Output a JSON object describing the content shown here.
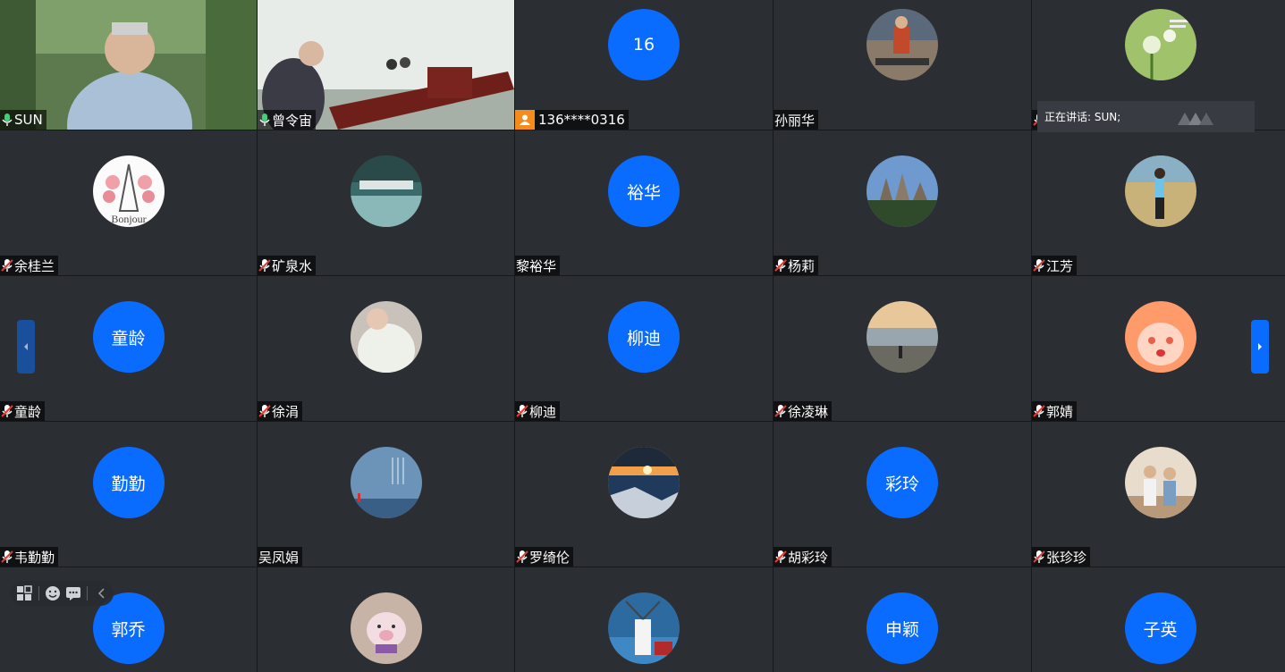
{
  "speaking_banner": "正在讲话: SUN;",
  "toolbar": {
    "buttons": [
      "layout-icon",
      "emoji-icon",
      "chat-icon",
      "collapse-icon"
    ]
  },
  "colors": {
    "accent_blue": "#0a6cff",
    "tile_bg": "#2b2e33",
    "speaking_border": "#4fd08a",
    "phone_icon_bg": "#f38b1d",
    "muted_mic_red": "#e53935"
  },
  "participants": [
    {
      "name": "SUN",
      "mic": "on",
      "type": "video",
      "scene": "outdoor"
    },
    {
      "name": "曾令宙",
      "mic": "on",
      "type": "video",
      "scene": "meeting-room"
    },
    {
      "name": "136****0316",
      "mic": "phone",
      "type": "initials",
      "initials": "16"
    },
    {
      "name": "孙丽华",
      "mic": "none",
      "type": "photo",
      "scene": "person-exercise"
    },
    {
      "name": "",
      "mic": "muted",
      "type": "photo",
      "scene": "flower"
    },
    {
      "name": "余桂兰",
      "mic": "muted",
      "type": "photo",
      "scene": "eiffel"
    },
    {
      "name": "矿泉水",
      "mic": "muted",
      "type": "photo",
      "scene": "bridge-lake"
    },
    {
      "name": "黎裕华",
      "mic": "none",
      "type": "initials",
      "initials": "裕华"
    },
    {
      "name": "杨莉",
      "mic": "muted",
      "type": "photo",
      "scene": "castle"
    },
    {
      "name": "江芳",
      "mic": "muted",
      "type": "photo",
      "scene": "person-field"
    },
    {
      "name": "童龄",
      "mic": "muted",
      "type": "initials",
      "initials": "童龄"
    },
    {
      "name": "徐涓",
      "mic": "muted",
      "type": "photo",
      "scene": "white-shirt"
    },
    {
      "name": "柳迪",
      "mic": "muted",
      "type": "initials",
      "initials": "柳迪"
    },
    {
      "name": "徐凌琳",
      "mic": "muted",
      "type": "photo",
      "scene": "sunset-beach"
    },
    {
      "name": "郭婧",
      "mic": "muted",
      "type": "photo",
      "scene": "anime-girl"
    },
    {
      "name": "韦勤勤",
      "mic": "muted",
      "type": "initials",
      "initials": "勤勤"
    },
    {
      "name": "吴凤娟",
      "mic": "none",
      "type": "photo",
      "scene": "sea-text"
    },
    {
      "name": "罗绮伦",
      "mic": "muted",
      "type": "photo",
      "scene": "sunset-rocks"
    },
    {
      "name": "胡彩玲",
      "mic": "muted",
      "type": "initials",
      "initials": "彩玲"
    },
    {
      "name": "张珍珍",
      "mic": "muted",
      "type": "photo",
      "scene": "couple"
    },
    {
      "name": "",
      "mic": "none",
      "type": "initials",
      "initials": "郭乔"
    },
    {
      "name": "",
      "mic": "none",
      "type": "photo",
      "scene": "pig-toy"
    },
    {
      "name": "",
      "mic": "none",
      "type": "photo",
      "scene": "windmill"
    },
    {
      "name": "",
      "mic": "none",
      "type": "initials",
      "initials": "申颖"
    },
    {
      "name": "",
      "mic": "none",
      "type": "initials",
      "initials": "子英"
    }
  ]
}
